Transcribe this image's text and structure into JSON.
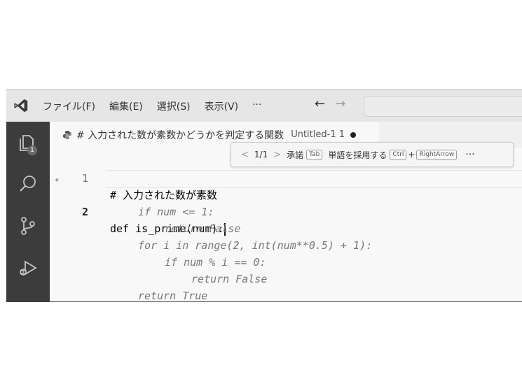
{
  "menu": {
    "items": [
      "ファイル(F)",
      "編集(E)",
      "選択(S)",
      "表示(V)",
      "···"
    ],
    "back": "←",
    "forward": "→"
  },
  "activity": {
    "explorer_badge": "1"
  },
  "tab": {
    "title": "# 入力された数が素数かどうかを判定する関数",
    "file": "Untitled-1 1"
  },
  "editor": {
    "lines": [
      {
        "num": "1",
        "text": "# 入力された数が素数"
      },
      {
        "num": "2",
        "text": "def is_prime(num):"
      }
    ],
    "ghost": [
      "if num <= 1:",
      "return False",
      "for i in range(2, int(num**0.5) + 1):",
      "if num % i == 0:",
      "return False",
      "return True"
    ]
  },
  "suggest_widget": {
    "prev": "<",
    "counter": "1/1",
    "next": ">",
    "accept": "承諾",
    "accept_key": "Tab",
    "accept_word": "単語を採用する",
    "ctrl_key": "Ctrl",
    "plus": "+",
    "right_key": "RightArrow",
    "more": "···"
  }
}
